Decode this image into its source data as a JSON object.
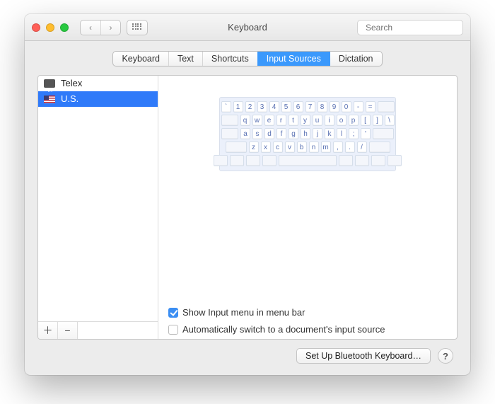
{
  "window": {
    "title": "Keyboard"
  },
  "toolbar": {
    "search_placeholder": "Search"
  },
  "tabs": [
    "Keyboard",
    "Text",
    "Shortcuts",
    "Input Sources",
    "Dictation"
  ],
  "selected_tab": 3,
  "input_sources": [
    {
      "name": "Telex",
      "icon": "vi-tx",
      "selected": false
    },
    {
      "name": "U.S.",
      "icon": "flag-us",
      "selected": true
    }
  ],
  "keyboard": {
    "rows": [
      [
        "`",
        "1",
        "2",
        "3",
        "4",
        "5",
        "6",
        "7",
        "8",
        "9",
        "0",
        "-",
        "="
      ],
      [
        "q",
        "w",
        "e",
        "r",
        "t",
        "y",
        "u",
        "i",
        "o",
        "p",
        "[",
        "]",
        "\\"
      ],
      [
        "a",
        "s",
        "d",
        "f",
        "g",
        "h",
        "j",
        "k",
        "l",
        ";",
        "'"
      ],
      [
        "z",
        "x",
        "c",
        "v",
        "b",
        "n",
        "m",
        ",",
        ".",
        "/"
      ]
    ]
  },
  "options": {
    "show_menu_label": "Show Input menu in menu bar",
    "show_menu_checked": true,
    "auto_switch_label": "Automatically switch to a document's input source",
    "auto_switch_checked": false
  },
  "footer": {
    "bluetooth_label": "Set Up Bluetooth Keyboard…",
    "help_label": "?"
  }
}
